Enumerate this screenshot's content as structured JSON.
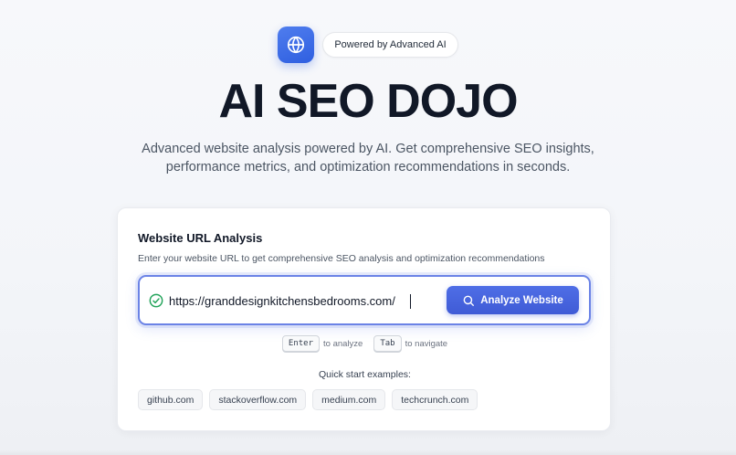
{
  "brand": {
    "badge_label": "Powered by Advanced AI",
    "logo_icon": "globe-icon",
    "accent_color": "#3f5bd6"
  },
  "hero": {
    "title": "AI SEO DOJO",
    "subtitle_line1": "Advanced website analysis powered by AI. Get comprehensive SEO insights,",
    "subtitle_line2": "performance metrics, and optimization recommendations in seconds."
  },
  "card": {
    "title": "Website URL Analysis",
    "subtitle": "Enter your website URL to get comprehensive SEO analysis and optimization recommendations",
    "url_value": "https://granddesignkitchensbedrooms.com/",
    "valid_icon": "check-circle-icon",
    "analyze_label": "Analyze Website",
    "analyze_icon": "search-icon",
    "hints": {
      "enter_key": "Enter",
      "enter_text": "to analyze",
      "tab_key": "Tab",
      "tab_text": "to navigate"
    },
    "quick_start_label": "Quick start examples:",
    "examples": [
      "github.com",
      "stackoverflow.com",
      "medium.com",
      "techcrunch.com"
    ]
  }
}
